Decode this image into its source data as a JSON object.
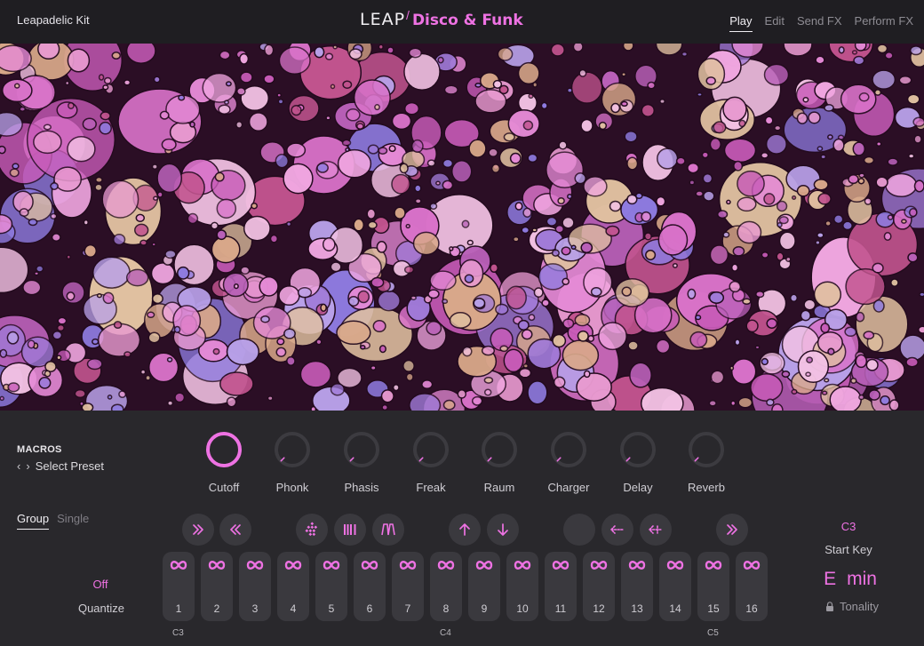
{
  "header": {
    "kit_name": "Leapadelic Kit",
    "logo_brand": "LEAP",
    "logo_title": "Disco & Funk",
    "nav": [
      {
        "label": "Play",
        "active": true
      },
      {
        "label": "Edit",
        "active": false
      },
      {
        "label": "Send FX",
        "active": false
      },
      {
        "label": "Perform FX",
        "active": false
      }
    ]
  },
  "macros": {
    "section_label": "MACROS",
    "preset_label": "Select Preset",
    "knobs": [
      {
        "label": "Cutoff",
        "active": true
      },
      {
        "label": "Phonk",
        "active": false
      },
      {
        "label": "Phasis",
        "active": false
      },
      {
        "label": "Freak",
        "active": false
      },
      {
        "label": "Raum",
        "active": false
      },
      {
        "label": "Charger",
        "active": false
      },
      {
        "label": "Delay",
        "active": false
      },
      {
        "label": "Reverb",
        "active": false
      }
    ]
  },
  "mode_tabs": [
    {
      "label": "Group",
      "active": true
    },
    {
      "label": "Single",
      "active": false
    }
  ],
  "toolbar_icons": [
    "fast-forward-icon",
    "rewind-icon",
    "grid-diamond-icon",
    "bars-icon",
    "envelope-icon",
    "arrow-up-icon",
    "arrow-down-icon",
    "swap-icon",
    "reverse-left-icon",
    "reverse-left-alt-icon",
    "fast-forward-alt-icon"
  ],
  "quantize": {
    "value": "Off",
    "label": "Quantize"
  },
  "pads": [
    "1",
    "2",
    "3",
    "4",
    "5",
    "6",
    "7",
    "8",
    "9",
    "10",
    "11",
    "12",
    "13",
    "14",
    "15",
    "16"
  ],
  "note_labels": [
    "C3",
    "C4",
    "C5"
  ],
  "start_key": {
    "value": "C3",
    "label": "Start Key"
  },
  "tonality": {
    "key": "E",
    "mode": "min",
    "label": "Tonality"
  },
  "colors": {
    "accent": "#ee72e3",
    "panel": "#29282c",
    "button": "#3a393e"
  }
}
